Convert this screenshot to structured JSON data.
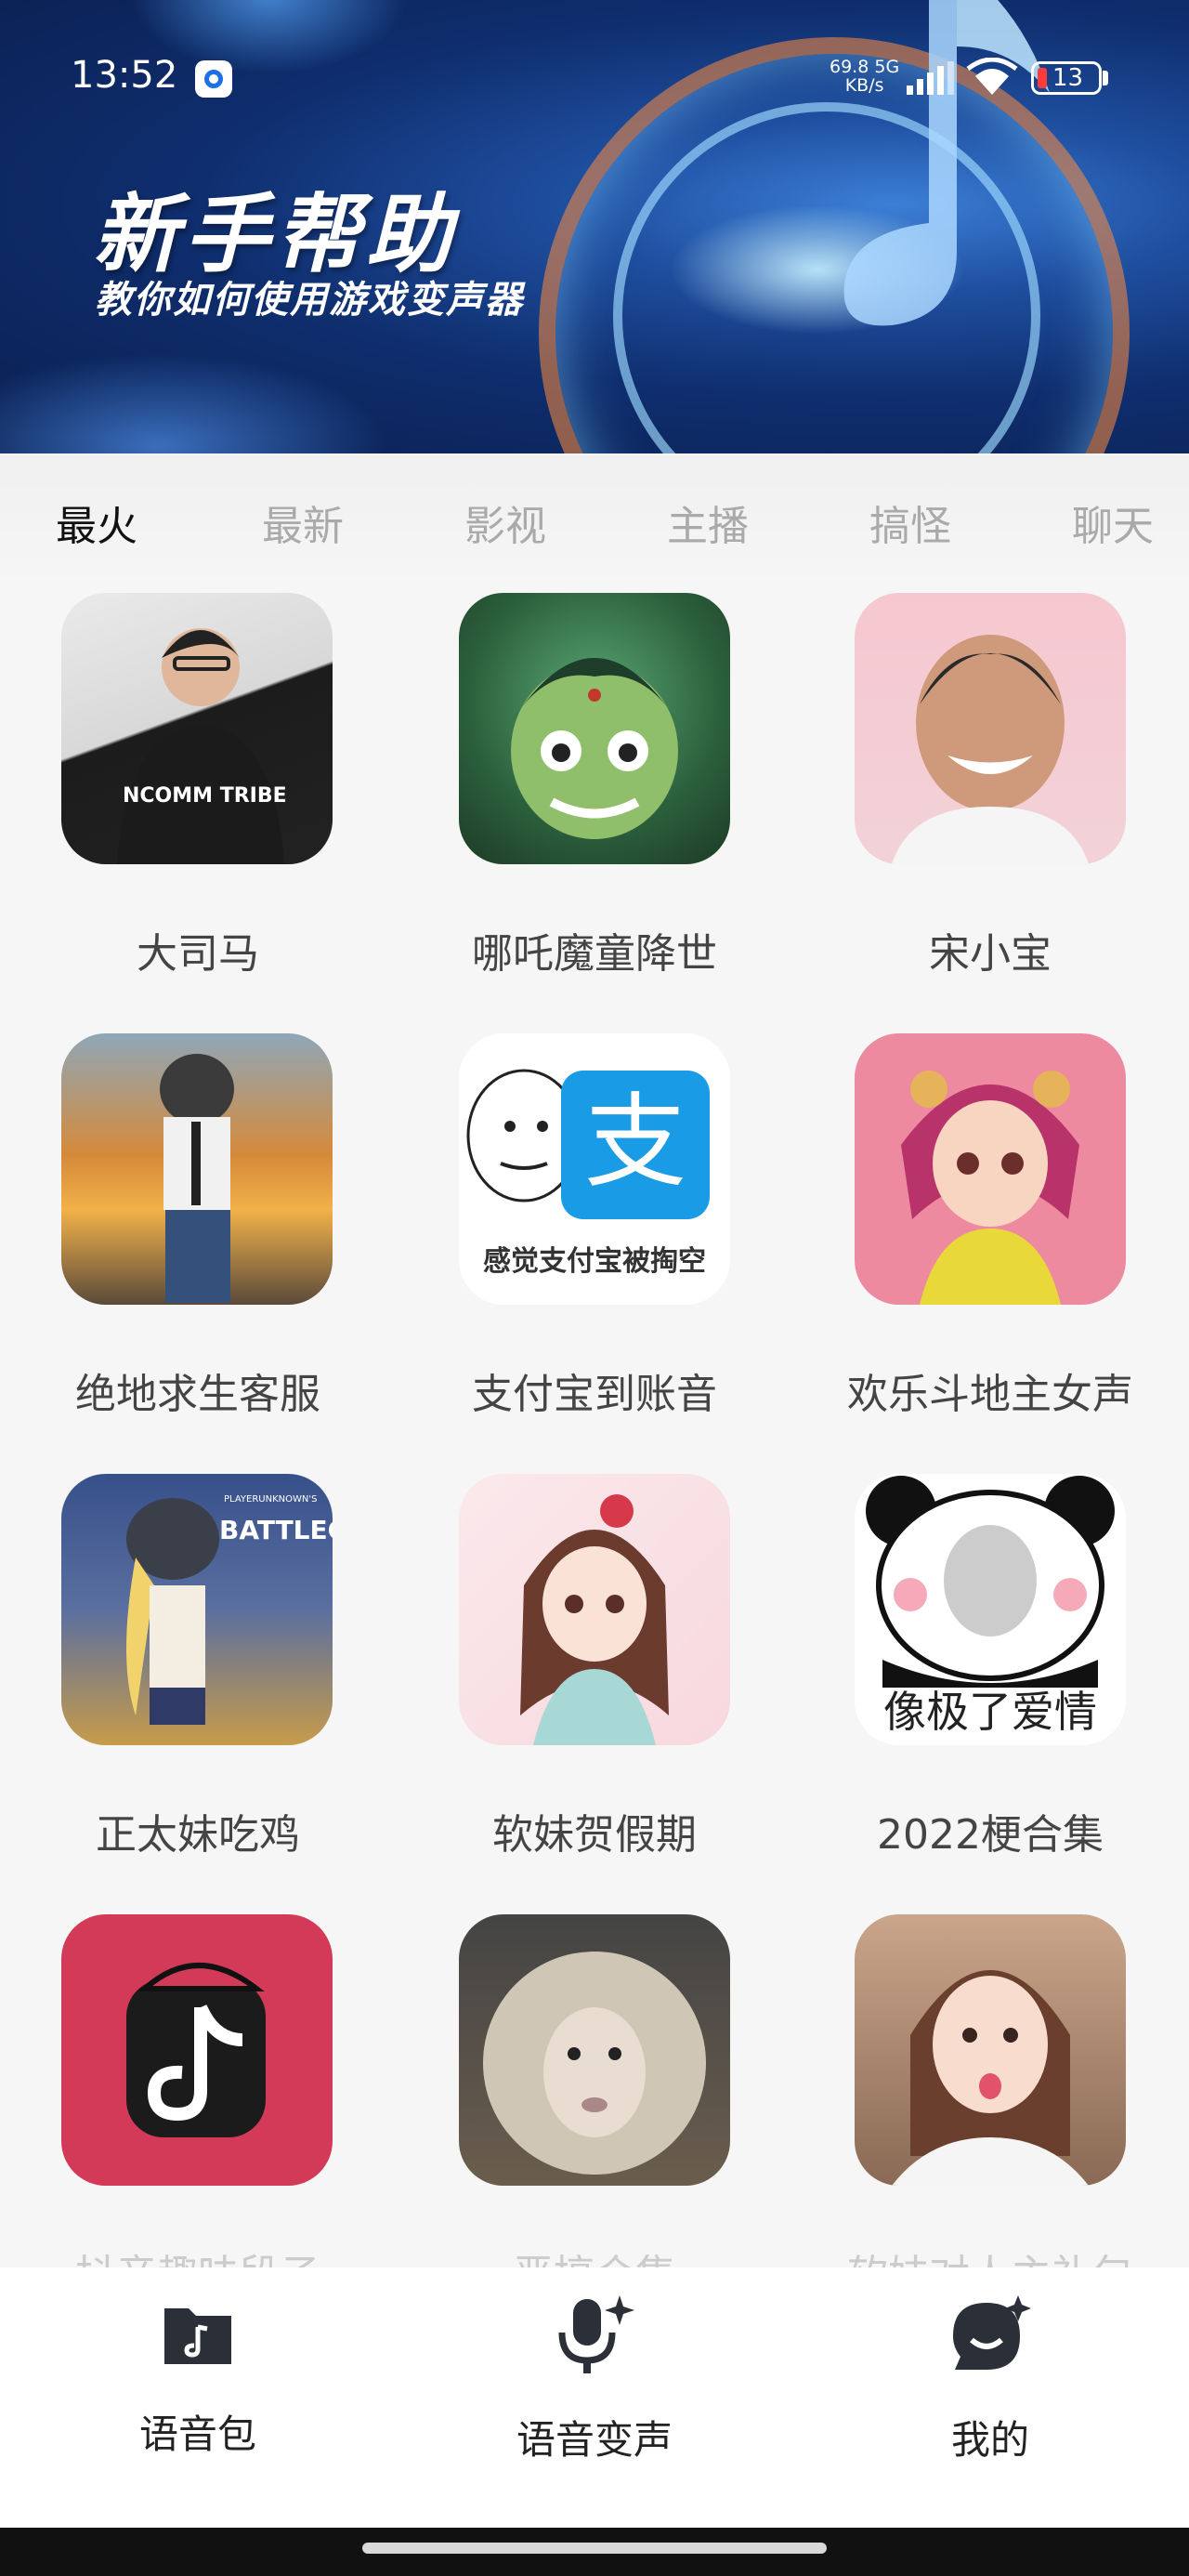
{
  "status_bar": {
    "time": "13:52",
    "network_speed": "69.8",
    "network_unit": "KB/s",
    "network_type": "5G",
    "battery": "13"
  },
  "banner": {
    "title": "新手帮助",
    "subtitle": "教你如何使用游戏变声器"
  },
  "tabs": [
    {
      "label": "最火",
      "active": true
    },
    {
      "label": "最新",
      "active": false
    },
    {
      "label": "影视",
      "active": false
    },
    {
      "label": "主播",
      "active": false
    },
    {
      "label": "搞怪",
      "active": false
    },
    {
      "label": "聊天",
      "active": false
    }
  ],
  "packs": [
    {
      "title": "大司马",
      "thumb_text": "NCOMM TRIBE"
    },
    {
      "title": "哪吒魔童降世",
      "thumb_text": ""
    },
    {
      "title": "宋小宝",
      "thumb_text": ""
    },
    {
      "title": "绝地求生客服",
      "thumb_text": ""
    },
    {
      "title": "支付宝到账音",
      "thumb_text": "感觉支付宝被掏空",
      "thumb_logo": "支"
    },
    {
      "title": "欢乐斗地主女声",
      "thumb_text": ""
    },
    {
      "title": "正太妹吃鸡",
      "thumb_text": "PLAYERUNKNOWN'S BATTLEGROUNDS"
    },
    {
      "title": "软妹贺假期",
      "thumb_text": ""
    },
    {
      "title": "2022梗合集",
      "thumb_text": "像极了爱情"
    },
    {
      "title": "抖音趣味段子",
      "thumb_text": ""
    },
    {
      "title": "恶搞合集",
      "thumb_text": ""
    },
    {
      "title": "软妹对人主礼包",
      "thumb_text": ""
    }
  ],
  "bottom_nav": [
    {
      "label": "语音包",
      "icon": "music-folder-icon"
    },
    {
      "label": "语音变声",
      "icon": "microphone-sparkle-icon"
    },
    {
      "label": "我的",
      "icon": "chat-smile-icon"
    }
  ],
  "colors": {
    "banner_dark": "#0a1f4f",
    "banner_light": "#3b7fd6",
    "tab_active": "#111111",
    "tab_inactive": "#aaaaaa"
  }
}
